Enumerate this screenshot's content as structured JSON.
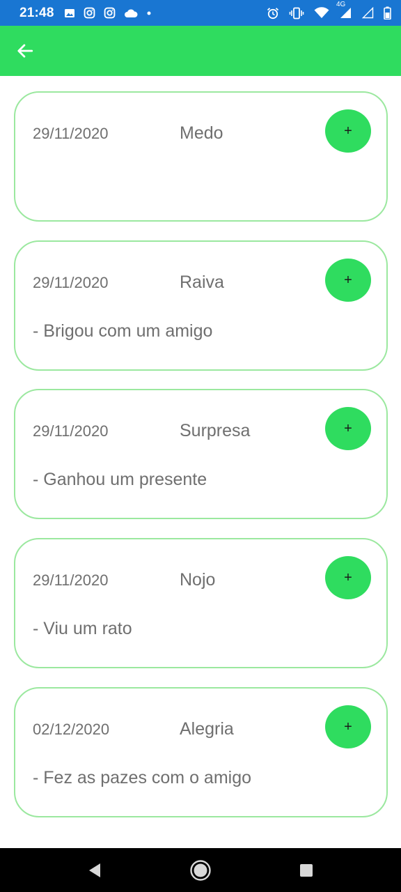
{
  "status_bar": {
    "time": "21:48",
    "network_label": "4G",
    "left_icons": [
      "image-icon",
      "instagram-icon",
      "instagram-icon",
      "cloud-icon",
      "dot-icon"
    ],
    "right_icons": [
      "alarm-icon",
      "vibrate-icon",
      "wifi-icon",
      "signal-icon",
      "signal-empty-icon",
      "battery-icon"
    ]
  },
  "app_bar": {
    "back_icon": "arrow-left-icon",
    "color": "#2fdc5f"
  },
  "cards": [
    {
      "date": "29/11/2020",
      "emotion": "Medo",
      "note": "",
      "button_label": "+"
    },
    {
      "date": "29/11/2020",
      "emotion": "Raiva",
      "note": "- Brigou com um amigo",
      "button_label": "+"
    },
    {
      "date": "29/11/2020",
      "emotion": "Surpresa",
      "note": "- Ganhou um presente",
      "button_label": "+"
    },
    {
      "date": "29/11/2020",
      "emotion": "Nojo",
      "note": "- Viu um rato",
      "button_label": "+"
    },
    {
      "date": "02/12/2020",
      "emotion": "Alegria",
      "note": "- Fez as pazes com o amigo",
      "button_label": "+"
    }
  ],
  "nav_bar": {
    "icons": [
      "back-triangle-icon",
      "home-circle-icon",
      "recents-square-icon"
    ]
  },
  "colors": {
    "accent": "#2fdc5f",
    "card_border": "#9be89f",
    "text": "#6f6f6f",
    "status_bar": "#1976d2"
  }
}
